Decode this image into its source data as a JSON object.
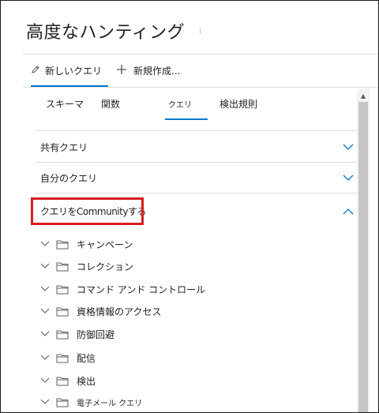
{
  "page": {
    "title": "高度なハンティング"
  },
  "commands": {
    "new_query": {
      "label": "新しいクエリ",
      "icon": "pencil-icon"
    },
    "create_new": {
      "label": "新規作成...",
      "icon": "plus-icon"
    }
  },
  "tabs": [
    {
      "label": "スキーマ",
      "active": false
    },
    {
      "label": "関数",
      "active": false
    },
    {
      "label": "クエリ",
      "active": true
    },
    {
      "label": "検出規則",
      "active": false
    }
  ],
  "sections": [
    {
      "label": "共有クエリ",
      "expanded": false,
      "icon": "chevron-down-icon"
    },
    {
      "label": "自分のクエリ",
      "expanded": false,
      "icon": "chevron-down-icon"
    },
    {
      "label": "クエリをCommunityする",
      "expanded": true,
      "icon": "chevron-up-icon"
    }
  ],
  "folders": [
    {
      "label": "キャンペーン"
    },
    {
      "label": "コレクション"
    },
    {
      "label": "コマンド アンド コントロール"
    },
    {
      "label": "資格情報のアクセス"
    },
    {
      "label": "防御回避"
    },
    {
      "label": "配信"
    },
    {
      "label": "検出"
    },
    {
      "label": "電子メール クエリ"
    }
  ],
  "colors": {
    "accent": "#0078d4",
    "highlight": "#d81e1e",
    "separator": "#e1dfdd",
    "text": "#201f1e"
  }
}
